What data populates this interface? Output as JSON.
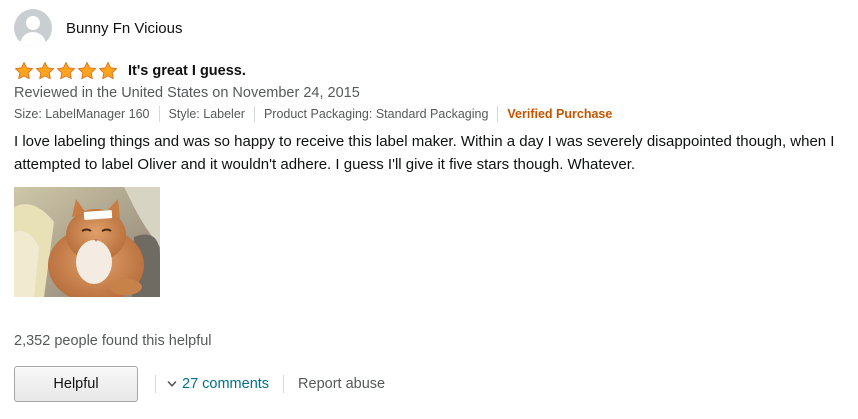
{
  "reviewer": {
    "name": "Bunny Fn Vicious",
    "avatar_icon": "default-user-avatar"
  },
  "rating": {
    "stars": 5,
    "max": 5,
    "color": "#ffa41c",
    "outline": "#de7921"
  },
  "review": {
    "title": "It's great I guess.",
    "date_text": "Reviewed in the United States on November 24, 2015",
    "meta": {
      "size": "Size: LabelManager 160",
      "style": "Style: Labeler",
      "packaging": "Product Packaging: Standard Packaging",
      "verified": "Verified Purchase"
    },
    "body": "I love labeling things and was so happy to receive this label maker. Within a day I was severely disappointed though, when I attempted to label Oliver and it wouldn't adhere. I guess I'll give it five stars though. Whatever.",
    "photo": {
      "subject": "orange cat with a label on its head"
    }
  },
  "helpful_count_text": "2,352 people found this helpful",
  "actions": {
    "helpful_label": "Helpful",
    "comments_label": "27 comments",
    "report_label": "Report abuse"
  },
  "colors": {
    "link": "#007185",
    "verified": "#c45500",
    "secondary_text": "#565959"
  }
}
